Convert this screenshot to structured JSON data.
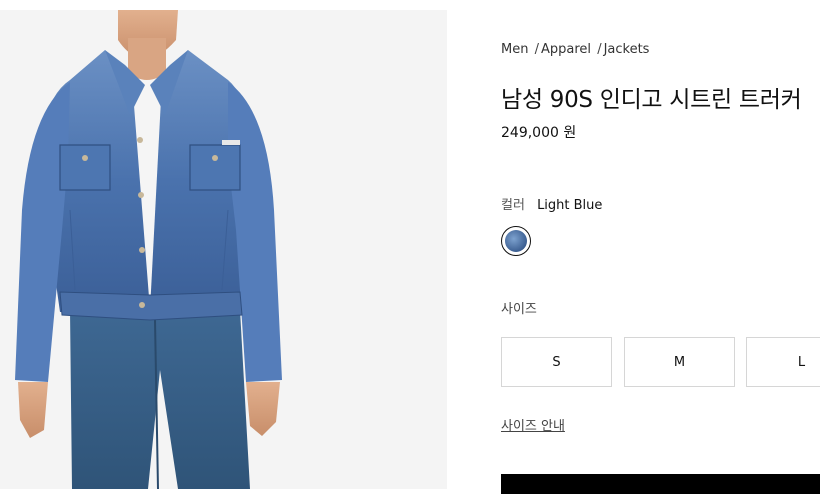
{
  "breadcrumb": {
    "items": [
      "Men",
      "Apparel",
      "Jackets"
    ],
    "separator": "/"
  },
  "product": {
    "title": "남성 90S 인디고 시트린 트러커",
    "price": "249,000 원"
  },
  "color": {
    "label": "컬러",
    "value": "Light Blue",
    "swatch_color": "#4a6ea3"
  },
  "size": {
    "label": "사이즈",
    "options": [
      "S",
      "M",
      "L"
    ],
    "guide_label": "사이즈 안내"
  },
  "colors": {
    "accent": "#000000",
    "denim": "#4a72ad",
    "jeans": "#355d86"
  }
}
